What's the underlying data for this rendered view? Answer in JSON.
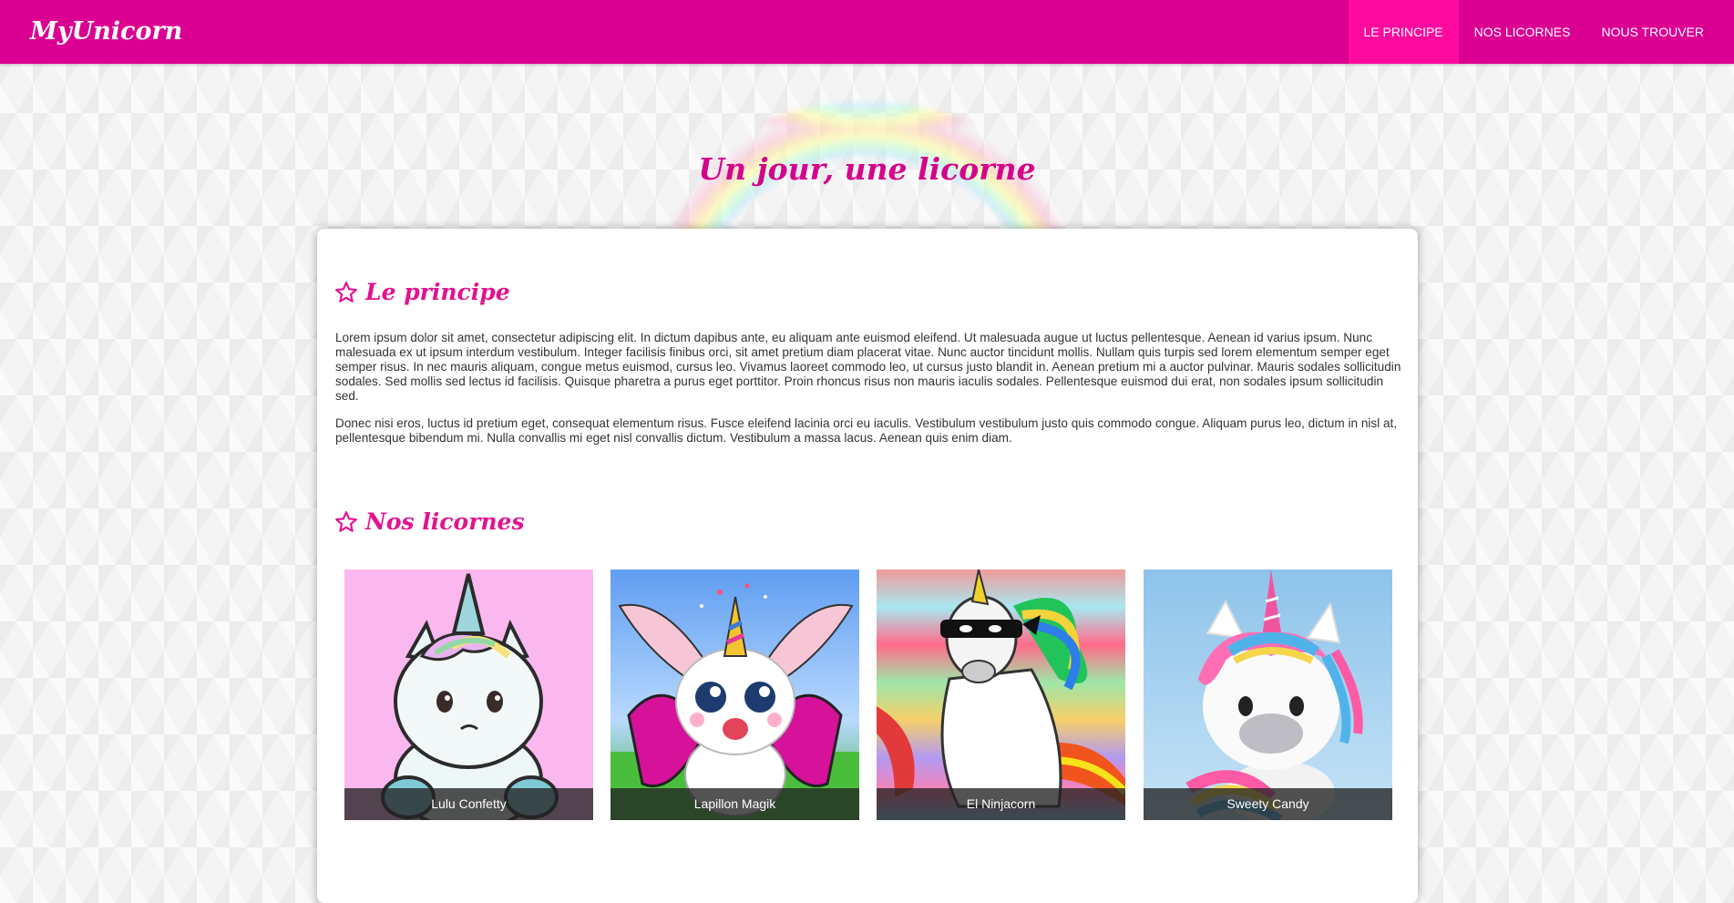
{
  "brand": "MyUnicorn",
  "nav": [
    {
      "label": "LE PRINCIPE",
      "active": true
    },
    {
      "label": "NOS LICORNES",
      "active": false
    },
    {
      "label": "NOUS TROUVER",
      "active": false
    }
  ],
  "hero": {
    "title": "Un jour, une licorne"
  },
  "principe": {
    "title": "Le principe",
    "paragraphs": [
      "Lorem ipsum dolor sit amet, consectetur adipiscing elit. In dictum dapibus ante, eu aliquam ante euismod eleifend. Ut malesuada augue ut luctus pellentesque. Aenean id varius ipsum. Nunc malesuada ex ut ipsum interdum vestibulum. Integer facilisis finibus orci, sit amet pretium diam placerat vitae. Nunc auctor tincidunt mollis. Nullam quis turpis sed lorem elementum semper eget semper risus. In nec mauris aliquam, congue metus euismod, cursus leo. Vivamus laoreet commodo leo, ut cursus justo blandit in. Aenean pretium mi a auctor pulvinar. Mauris sodales sollicitudin sodales. Sed mollis sed lectus id facilisis. Quisque pharetra a purus eget porttitor. Proin rhoncus risus non mauris iaculis sodales. Pellentesque euismod dui erat, non sodales ipsum sollicitudin sed.",
      "Donec nisi eros, luctus id pretium eget, consequat elementum risus. Fusce eleifend lacinia orci eu iaculis. Vestibulum vestibulum justo quis commodo congue. Aliquam purus leo, dictum in nisl at, pellentesque bibendum mi. Nulla convallis mi eget nisl convallis dictum. Vestibulum a massa lacus. Aenean quis enim diam."
    ]
  },
  "licornes": {
    "title": "Nos licornes",
    "items": [
      {
        "name": "Lulu Confetty"
      },
      {
        "name": "Lapillon Magik"
      },
      {
        "name": "El Ninjacorn"
      },
      {
        "name": "Sweety Candy"
      }
    ]
  },
  "colors": {
    "primary": "#db0091",
    "nav_active": "#ff0a9e",
    "heading": "#e3128f"
  }
}
